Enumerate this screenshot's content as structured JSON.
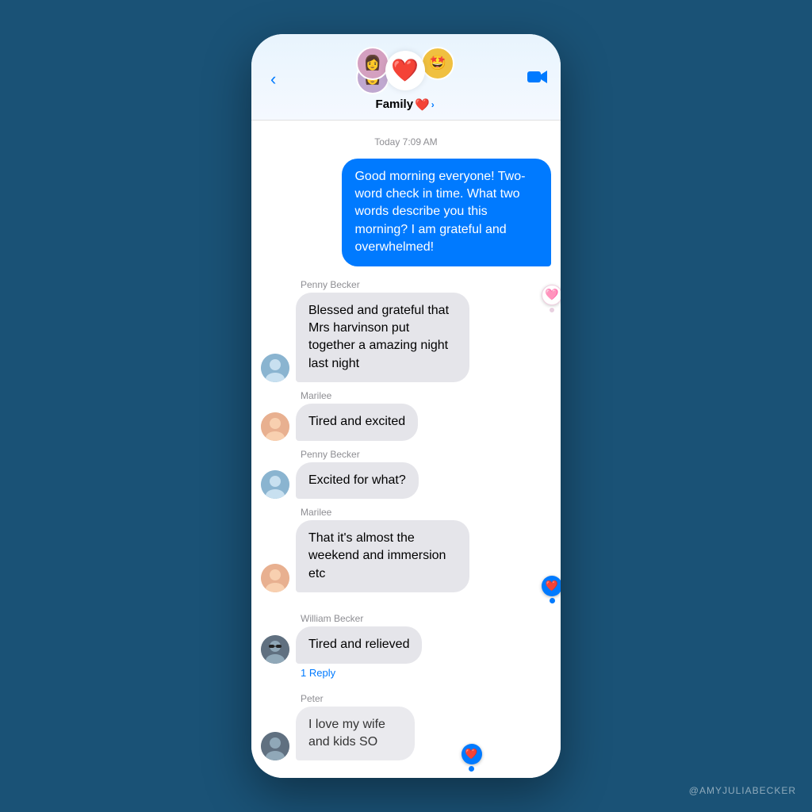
{
  "header": {
    "back_label": "‹",
    "group_name": "Family",
    "heart_emoji": "❤️",
    "chevron": "›",
    "avatars": {
      "center": "❤️",
      "top_left": "👩",
      "bottom_left": "👩",
      "top_right": "🤩"
    },
    "video_icon": "📹"
  },
  "timestamp": "Today 7:09 AM",
  "messages": [
    {
      "id": "msg1",
      "type": "outgoing",
      "text": "Good morning everyone! Two-word check in time. What two words describe you this morning? I am grateful and overwhelmed!"
    },
    {
      "id": "msg2",
      "type": "incoming",
      "sender": "Penny Becker",
      "avatar_emoji": "👩",
      "avatar_class": "avatar-penny",
      "text": "Blessed and grateful that Mrs harvinson put together a amazing night last night",
      "reaction": "❤️",
      "reaction_type": "pink"
    },
    {
      "id": "msg3",
      "type": "incoming",
      "sender": "Marilee",
      "avatar_emoji": "🎎",
      "avatar_class": "avatar-marilee",
      "text": "Tired and excited"
    },
    {
      "id": "msg4",
      "type": "incoming",
      "sender": "Penny Becker",
      "avatar_emoji": "👩",
      "avatar_class": "avatar-penny",
      "text": "Excited for what?"
    },
    {
      "id": "msg5",
      "type": "incoming",
      "sender": "Marilee",
      "avatar_emoji": "🎎",
      "avatar_class": "avatar-marilee",
      "text": "That it's almost the weekend and immersion etc",
      "reaction": "❤️",
      "reaction_type": "blue"
    },
    {
      "id": "msg6",
      "type": "incoming",
      "sender": "William Becker",
      "avatar_emoji": "🕶️",
      "avatar_class": "avatar-william",
      "text": "Tired and relieved",
      "reply_text": "1 Reply"
    },
    {
      "id": "msg7",
      "type": "incoming",
      "sender": "Peter",
      "avatar_emoji": "👨",
      "avatar_class": "avatar-william",
      "text": "I love my wife and kids SO",
      "partial": true,
      "reaction_type": "blue"
    }
  ],
  "watermark": "@AMYJULIABECKER"
}
